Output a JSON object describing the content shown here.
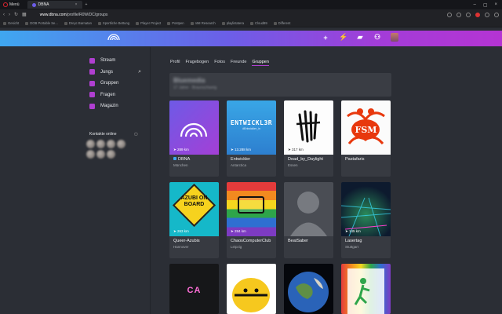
{
  "browser": {
    "menu_label": "Menü",
    "tab_title": "DBNA",
    "url_host": "www.dbna.com",
    "url_path": "/profile/R0W/DC/groups",
    "bookmarks": [
      "Gesicht",
      "DOB Portable Se...",
      "Dreyc Barnatan",
      "Sportliche Bettung",
      "Player Project",
      "Postpen",
      "nMI Research",
      "playlistatera",
      "Cloud89",
      "Different"
    ]
  },
  "appbar": {
    "icons": [
      "plus-icon",
      "bolt-icon",
      "chat-icon",
      "people-icon"
    ]
  },
  "sidebar": {
    "items": [
      {
        "label": "Stream",
        "icon": "stream-icon"
      },
      {
        "label": "Jungs",
        "icon": "people-icon"
      },
      {
        "label": "Gruppen",
        "icon": "groups-icon"
      },
      {
        "label": "Fragen",
        "icon": "question-icon"
      },
      {
        "label": "Magazin",
        "icon": "magazine-icon"
      }
    ],
    "contacts_title": "Kontakte online"
  },
  "profile_tabs": [
    "Profil",
    "Fragebogen",
    "Fotos",
    "Freunde",
    "Gruppen"
  ],
  "active_tab": "Gruppen",
  "banner": {
    "title": "Bluemedia",
    "subtitle": "17 Jahre · Braunschweig"
  },
  "groups": [
    {
      "name": "DBNA",
      "location": "München",
      "distance": "289 km",
      "badge": true
    },
    {
      "name": "Entwickler",
      "location": "Antarctica",
      "distance": "13.288 km",
      "image_text": "ENTWICKL3R",
      "image_subtext": "#Entwickler_in"
    },
    {
      "name": "Dead_by_Daylight",
      "location": "Essen",
      "distance": "317 km"
    },
    {
      "name": "Pastafaris",
      "location": "",
      "distance": "",
      "image_text": "FSM"
    },
    {
      "name": "Queer-Azubis",
      "location": "Hannover",
      "distance": "263 km",
      "image_text": "AZUBI ON BOARD"
    },
    {
      "name": "ChaosComputerClub",
      "location": "Leipzig",
      "distance": "284 km"
    },
    {
      "name": "BeatSaber",
      "location": "",
      "distance": ""
    },
    {
      "name": "Lasertag",
      "location": "Stuttgart",
      "distance": "145 km"
    }
  ],
  "groups_partial": [
    {
      "image_text": "CA"
    },
    {},
    {},
    {}
  ]
}
